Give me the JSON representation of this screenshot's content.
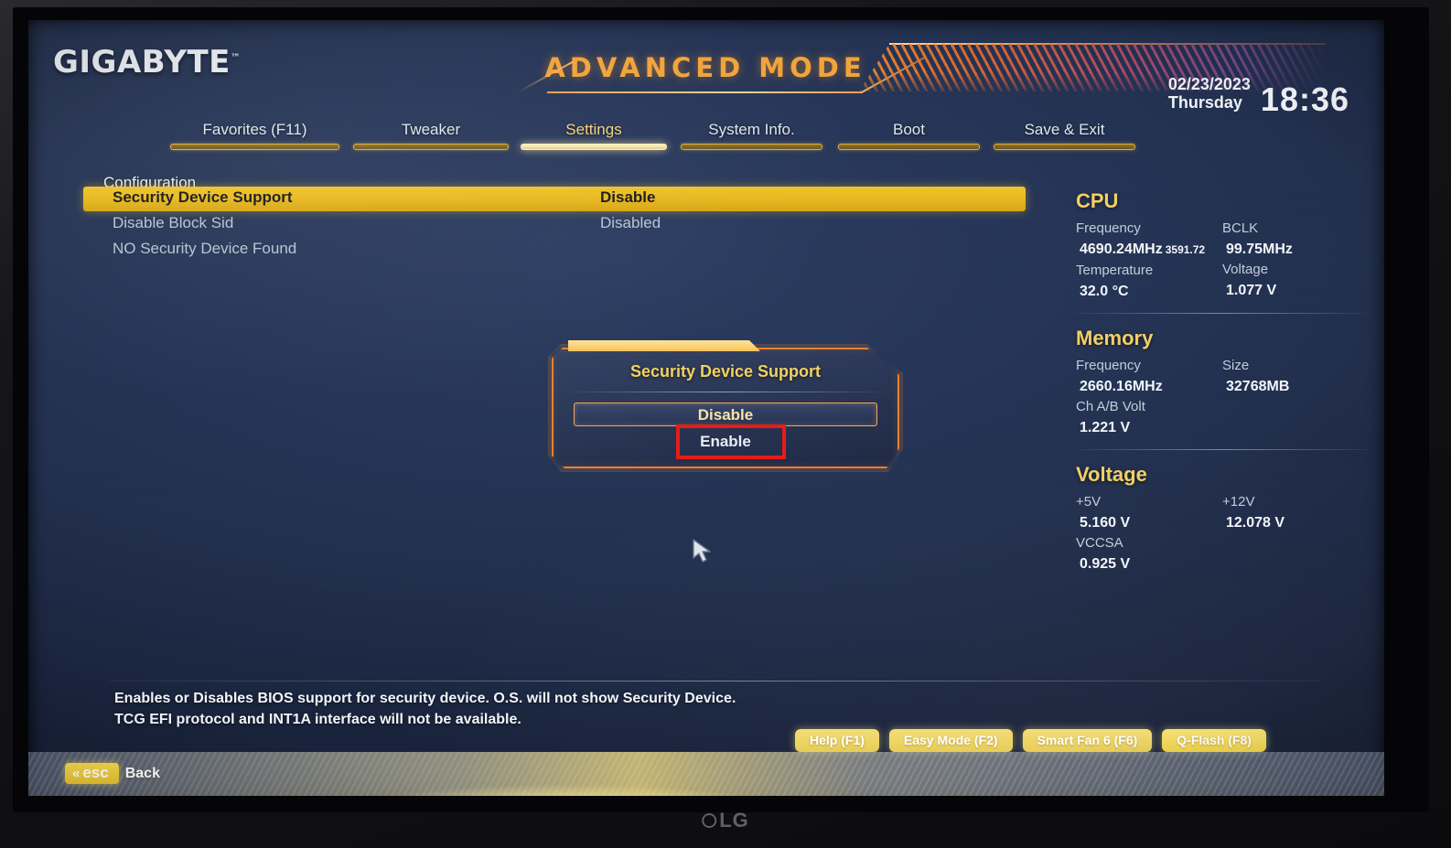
{
  "monitor": {
    "brand": "LG"
  },
  "header": {
    "logo": "GIGABYTE",
    "logo_tm": "™",
    "mode_title": "ADVANCED MODE",
    "clock": {
      "date": "02/23/2023",
      "weekday": "Thursday",
      "time": "18:36"
    }
  },
  "nav": {
    "items": [
      {
        "label": "Favorites (F11)",
        "active": false
      },
      {
        "label": "Tweaker",
        "active": false
      },
      {
        "label": "Settings",
        "active": true
      },
      {
        "label": "System Info.",
        "active": false
      },
      {
        "label": "Boot",
        "active": false
      },
      {
        "label": "Save & Exit",
        "active": false
      }
    ]
  },
  "main": {
    "section_title": "Configuration",
    "rows": [
      {
        "label": "Security Device Support",
        "value": "Disable",
        "highlighted": true
      },
      {
        "label": "Disable Block Sid",
        "value": "Disabled",
        "highlighted": false
      },
      {
        "label": "NO Security Device Found",
        "value": "",
        "highlighted": false
      }
    ]
  },
  "dialog": {
    "title": "Security Device Support",
    "options": [
      {
        "label": "Disable",
        "selected": true
      },
      {
        "label": "Enable",
        "selected": false,
        "annotated": true
      }
    ]
  },
  "info_panel": {
    "groups": [
      {
        "heading": "CPU",
        "pairs": [
          {
            "key": "Frequency",
            "value": "4690.24MHz",
            "value_small": "3591.72"
          },
          {
            "key": "BCLK",
            "value": "99.75MHz",
            "value_small": ""
          },
          {
            "key": "Temperature",
            "value": "32.0 °C",
            "value_small": ""
          },
          {
            "key": "Voltage",
            "value": "1.077 V",
            "value_small": ""
          }
        ]
      },
      {
        "heading": "Memory",
        "pairs": [
          {
            "key": "Frequency",
            "value": "2660.16MHz",
            "value_small": ""
          },
          {
            "key": "Size",
            "value": "32768MB",
            "value_small": ""
          },
          {
            "key": "Ch A/B Volt",
            "value": "1.221 V",
            "value_small": ""
          },
          {
            "key": "",
            "value": "",
            "value_small": ""
          }
        ]
      },
      {
        "heading": "Voltage",
        "pairs": [
          {
            "key": "+5V",
            "value": "5.160 V",
            "value_small": ""
          },
          {
            "key": "+12V",
            "value": "12.078 V",
            "value_small": ""
          },
          {
            "key": "VCCSA",
            "value": "0.925 V",
            "value_small": ""
          },
          {
            "key": "",
            "value": "",
            "value_small": ""
          }
        ]
      }
    ]
  },
  "help": {
    "line1": "Enables or Disables BIOS support for security device. O.S. will not show Security Device.",
    "line2": "TCG EFI protocol and INT1A interface will not be available."
  },
  "function_buttons": [
    {
      "label": "Help (F1)",
      "bright": false
    },
    {
      "label": "Easy Mode (F2)",
      "bright": false
    },
    {
      "label": "Smart Fan 6 (F6)",
      "bright": false
    },
    {
      "label": "Q-Flash (F8)",
      "bright": true
    }
  ],
  "bottom_bar": {
    "esc_key": "esc",
    "esc_chevron": "«",
    "back_label": "Back"
  },
  "colors": {
    "accent_gold": "#f3cf63",
    "highlight_yellow": "#e7b81f",
    "dialog_orange": "#f0802c",
    "annotation_red": "#e81b15",
    "screen_blue": "#22304f"
  }
}
